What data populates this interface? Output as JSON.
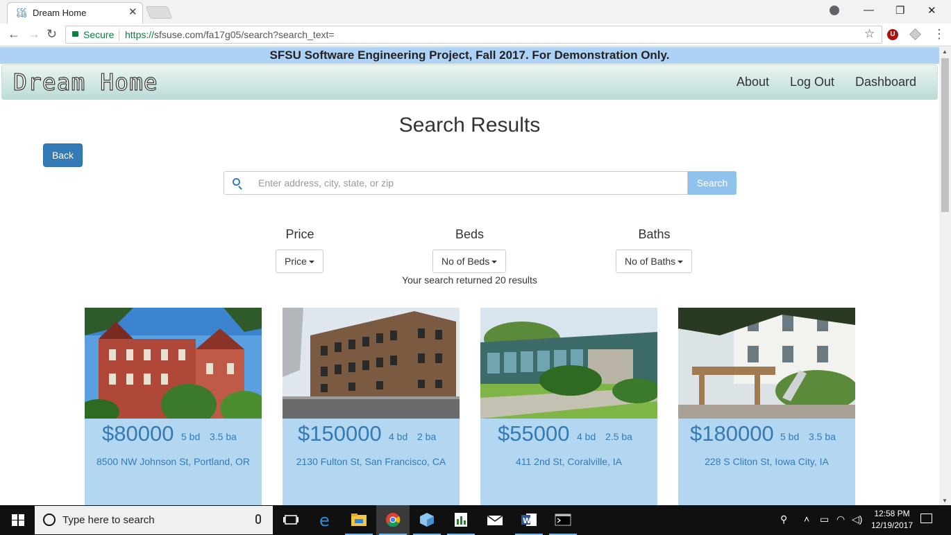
{
  "browser": {
    "tab_title": "Dream Home",
    "tab_favicon": "CSC 648",
    "secure_label": "Secure",
    "url_scheme": "https://",
    "url_rest": "sfsuse.com/fa17g05/search?search_text="
  },
  "banner": "SFSU Software Engineering Project, Fall 2017. For Demonstration Only.",
  "navbar": {
    "brand": "Dream Home",
    "links": [
      "About",
      "Log Out",
      "Dashboard"
    ]
  },
  "page": {
    "title": "Search Results",
    "back_label": "Back",
    "search_placeholder": "Enter address, city, state, or zip",
    "search_button": "Search",
    "result_count": "Your search returned 20 results"
  },
  "filters": [
    {
      "label": "Price",
      "button": "Price"
    },
    {
      "label": "Beds",
      "button": "No of Beds"
    },
    {
      "label": "Baths",
      "button": "No of Baths"
    }
  ],
  "listings": [
    {
      "price": "$80000",
      "beds": "5 bd",
      "baths": "3.5 ba",
      "address": "8500 NW Johnson St, Portland, OR"
    },
    {
      "price": "$150000",
      "beds": "4 bd",
      "baths": "2 ba",
      "address": "2130 Fulton St, San Francisco, CA"
    },
    {
      "price": "$55000",
      "beds": "4 bd",
      "baths": "2.5 ba",
      "address": "411 2nd St, Coralville, IA"
    },
    {
      "price": "$180000",
      "beds": "5 bd",
      "baths": "3.5 ba",
      "address": "228 S Cliton St, Iowa City, IA"
    }
  ],
  "taskbar": {
    "search_text": "Type here to search",
    "time": "12:58 PM",
    "date": "12/19/2017",
    "apps": [
      "task-view-icon",
      "edge-icon",
      "file-explorer-icon",
      "chrome-icon",
      "3d-app-icon",
      "sheets-icon",
      "mail-icon",
      "word-icon",
      "terminal-icon"
    ]
  },
  "colors": {
    "banner_bg": "#aed2f5",
    "primary": "#337ab7",
    "card_bg": "#b3d7f0",
    "search_btn": "#8fc2ec"
  }
}
